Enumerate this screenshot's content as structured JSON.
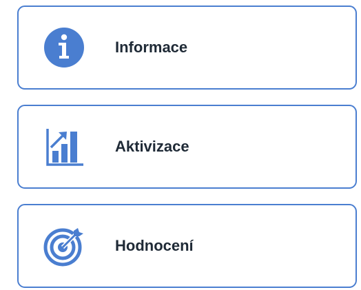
{
  "menu": {
    "items": [
      {
        "label": "Informace",
        "icon": "info-icon"
      },
      {
        "label": "Aktivizace",
        "icon": "growth-chart-icon"
      },
      {
        "label": "Hodnocení",
        "icon": "target-icon"
      }
    ]
  },
  "colors": {
    "accent": "#4a7ed0",
    "border": "#4a7ed0",
    "text": "#1f2a36",
    "background": "#ffffff"
  }
}
